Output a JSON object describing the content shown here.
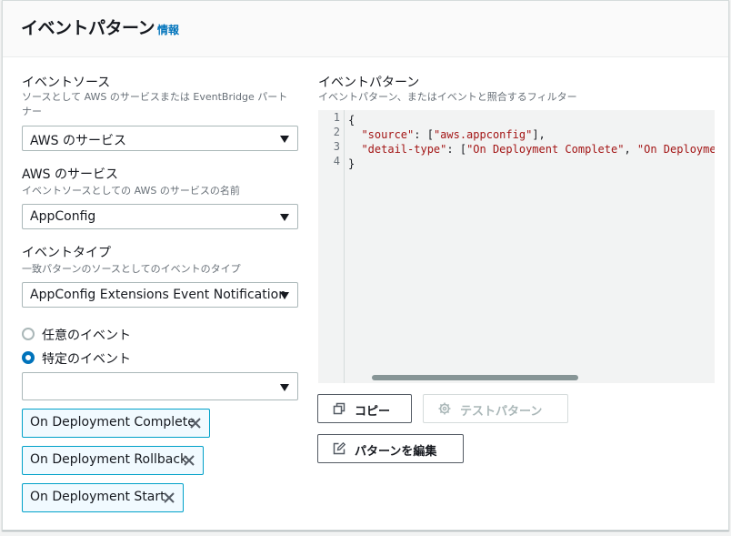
{
  "header": {
    "title": "イベントパターン",
    "info_link": "情報"
  },
  "event_source": {
    "label": "イベントソース",
    "description": "ソースとして AWS のサービスまたは EventBridge パートナー",
    "selected": "AWS のサービス"
  },
  "aws_service": {
    "label": "AWS のサービス",
    "description": "イベントソースとしての AWS のサービスの名前",
    "selected": "AppConfig"
  },
  "event_type": {
    "label": "イベントタイプ",
    "description": "一致パターンのソースとしてのイベントのタイプ",
    "selected": "AppConfig Extensions Event Notification"
  },
  "event_choice": {
    "any_label": "任意のイベント",
    "specific_label": "特定のイベント",
    "selected": "specific",
    "specific_select_value": ""
  },
  "tokens": [
    {
      "label": "On Deployment Complete"
    },
    {
      "label": "On Deployment Rollback"
    },
    {
      "label": "On Deployment Start"
    }
  ],
  "pattern": {
    "label": "イベントパターン",
    "description": "イベントパターン、またはイベントと照合するフィルター",
    "line_numbers": [
      "1",
      "2",
      "3",
      "4"
    ],
    "line1": "{",
    "line2_key": "\"source\"",
    "line2_sep": ": [",
    "line2_val": "\"aws.appconfig\"",
    "line2_end": "],",
    "line3_key": "\"detail-type\"",
    "line3_sep": ": [",
    "line3_val1": "\"On Deployment Complete\"",
    "line3_comma": ", ",
    "line3_val2": "\"On Deployme",
    "line4": "}"
  },
  "buttons": {
    "copy": "コピー",
    "test": "テストパターン",
    "edit": "パターンを編集"
  },
  "colors": {
    "accent": "#0073bb",
    "token_border": "#00a1c9",
    "token_bg": "#f1faff",
    "code_string": "#a31515"
  }
}
